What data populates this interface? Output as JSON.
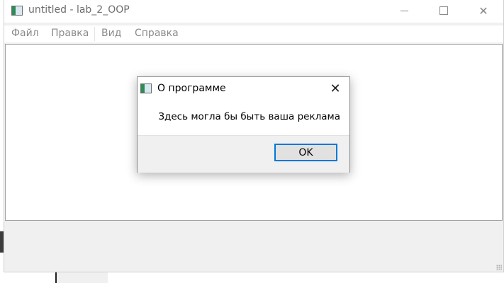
{
  "window": {
    "title": "untitled - lab_2_OOP",
    "icon": "app-window-icon",
    "controls": {
      "minimize_icon": "minimize-icon",
      "maximize_icon": "maximize-icon",
      "close_glyph": "✕"
    }
  },
  "menubar": {
    "items": [
      {
        "label": "Файл"
      },
      {
        "label": "Правка"
      },
      {
        "label": "Вид"
      },
      {
        "label": "Справка"
      }
    ]
  },
  "dialog": {
    "title": "О программе",
    "message": "Здесь могла бы быть ваша реклама",
    "close_glyph": "✕",
    "ok_label": "OK"
  },
  "colors": {
    "accent": "#0078d7",
    "window_bg": "#f0f0f0",
    "content_bg": "#ffffff"
  }
}
